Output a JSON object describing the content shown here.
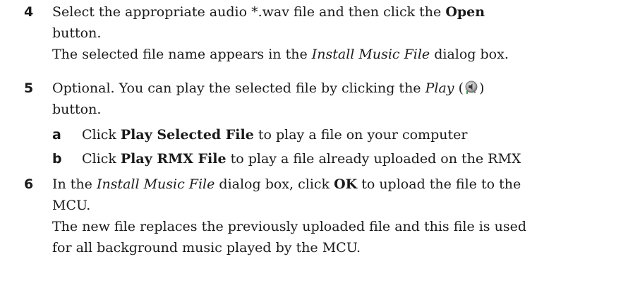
{
  "steps": [
    {
      "number": "4",
      "line1_pre": "Select the appropriate audio *.wav file and then click the ",
      "line1_bold": "Open",
      "line2": "button.",
      "line3_pre": "The selected file name appears in the ",
      "line3_italic": "Install Music File",
      "line3_post": " dialog box."
    },
    {
      "number": "5",
      "line1_pre": "Optional. You can play the selected file by clicking the ",
      "line1_italic": "Play",
      "line1_paren_open": " (",
      "line1_paren_close": ")",
      "icon": "play-speaker-icon",
      "line2": "button.",
      "subs": [
        {
          "letter": "a",
          "pre": "Click ",
          "bold": "Play Selected File",
          "post": " to play a file on your computer"
        },
        {
          "letter": "b",
          "pre": "Click ",
          "bold": "Play RMX File",
          "post": " to play a file already uploaded on the RMX"
        }
      ]
    },
    {
      "number": "6",
      "line1_pre": "In the ",
      "line1_italic": "Install Music File",
      "line1_mid": " dialog box, click ",
      "line1_bold": "OK",
      "line1_post": " to upload the file to the",
      "line2": "MCU.",
      "line3": "The new file replaces the previously uploaded file and this file is used",
      "line4": "for all background music played by the MCU."
    }
  ]
}
